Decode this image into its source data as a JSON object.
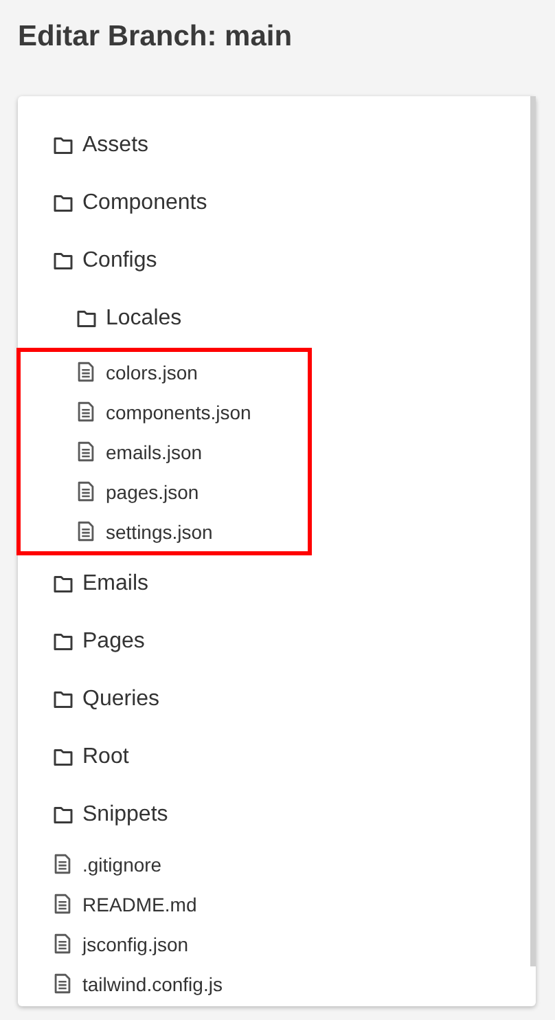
{
  "title": "Editar Branch: main",
  "tree": [
    {
      "kind": "folder",
      "name": "Assets"
    },
    {
      "kind": "folder",
      "name": "Components"
    },
    {
      "kind": "folder",
      "name": "Configs",
      "children": [
        {
          "kind": "folder",
          "name": "Locales",
          "highlighted": false
        },
        {
          "kind": "file",
          "name": "colors.json",
          "highlighted": true
        },
        {
          "kind": "file",
          "name": "components.json",
          "highlighted": true
        },
        {
          "kind": "file",
          "name": "emails.json",
          "highlighted": true
        },
        {
          "kind": "file",
          "name": "pages.json",
          "highlighted": true
        },
        {
          "kind": "file",
          "name": "settings.json",
          "highlighted": true
        }
      ]
    },
    {
      "kind": "folder",
      "name": "Emails"
    },
    {
      "kind": "folder",
      "name": "Pages"
    },
    {
      "kind": "folder",
      "name": "Queries"
    },
    {
      "kind": "folder",
      "name": "Root"
    },
    {
      "kind": "folder",
      "name": "Snippets"
    },
    {
      "kind": "file",
      "name": ".gitignore"
    },
    {
      "kind": "file",
      "name": "README.md"
    },
    {
      "kind": "file",
      "name": "jsconfig.json"
    },
    {
      "kind": "file",
      "name": "tailwind.config.js"
    }
  ]
}
